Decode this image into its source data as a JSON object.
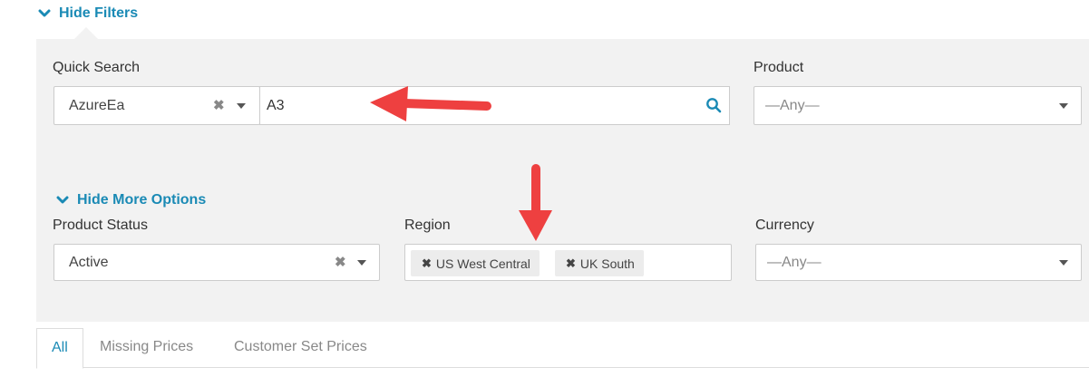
{
  "filters": {
    "toggle_label": "Hide Filters"
  },
  "quick_search": {
    "label": "Quick Search",
    "scope_value": "AzureEa",
    "query_value": "A3"
  },
  "product": {
    "label": "Product",
    "value": "—Any—"
  },
  "more_options": {
    "toggle_label": "Hide More Options"
  },
  "product_status": {
    "label": "Product Status",
    "value": "Active"
  },
  "region": {
    "label": "Region",
    "tags": [
      "US West Central",
      "UK South"
    ]
  },
  "currency": {
    "label": "Currency",
    "value": "—Any—"
  },
  "tabs": [
    {
      "label": "All",
      "active": true
    },
    {
      "label": "Missing Prices",
      "active": false
    },
    {
      "label": "Customer Set Prices",
      "active": false
    }
  ],
  "colors": {
    "accent": "#1a8ab5",
    "panel_bg": "#f2f2f2",
    "annotation_arrow": "#ee4040"
  },
  "icons": {
    "clear": "✖",
    "chevron": "chevron-down-icon",
    "search": "search-icon",
    "dropdown": "caret-down-icon"
  }
}
